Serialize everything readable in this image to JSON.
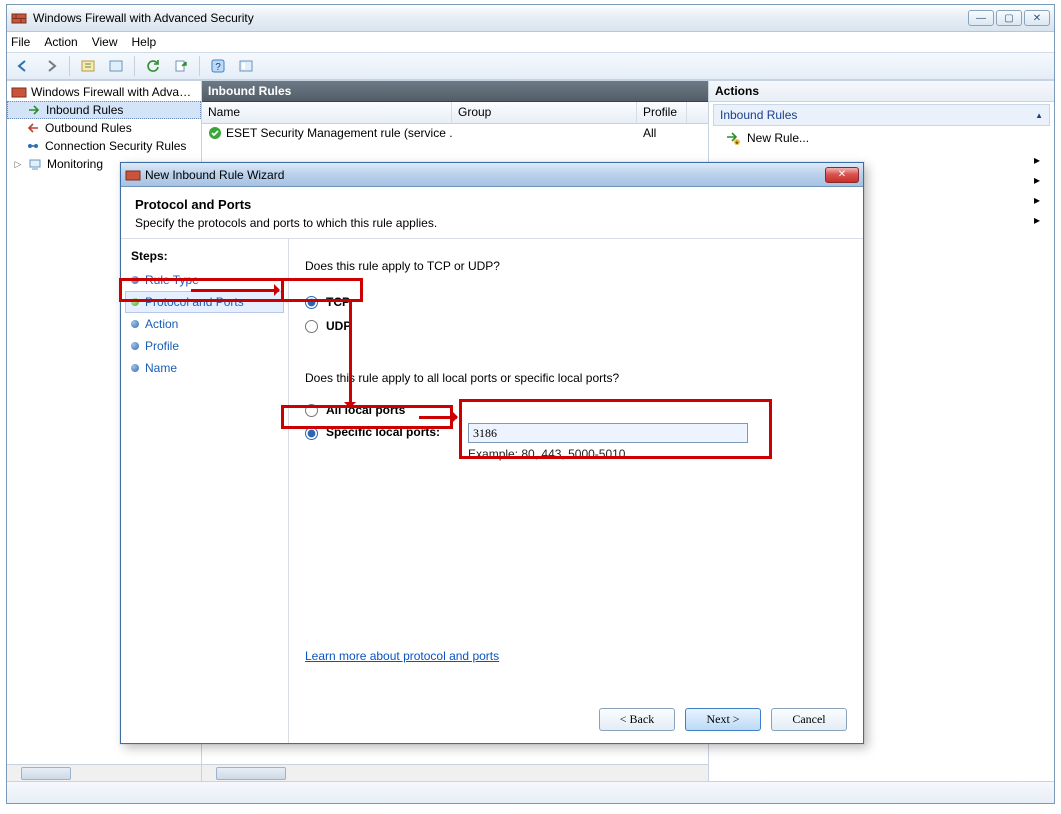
{
  "window": {
    "title": "Windows Firewall with Advanced Security",
    "menus": [
      "File",
      "Action",
      "View",
      "Help"
    ]
  },
  "win_buttons": {
    "min": "—",
    "max": "▢",
    "close": "✕"
  },
  "tree": {
    "root": "Windows Firewall with Advanced Security",
    "items": [
      "Inbound Rules",
      "Outbound Rules",
      "Connection Security Rules",
      "Monitoring"
    ]
  },
  "center": {
    "title": "Inbound Rules",
    "columns": {
      "name": "Name",
      "group": "Group",
      "profile": "Profile"
    },
    "col_widths": {
      "name": 250,
      "group": 185,
      "profile": 50
    },
    "row": {
      "name": "ESET Security Management rule (service ...",
      "group": "",
      "profile": "All"
    }
  },
  "actions": {
    "header": "Actions",
    "section": "Inbound Rules",
    "new_rule": "New Rule..."
  },
  "dialog": {
    "title": "New Inbound Rule Wizard",
    "heading": "Protocol and Ports",
    "subheading": "Specify the protocols and ports to which this rule applies.",
    "steps_label": "Steps:",
    "steps": [
      "Rule Type",
      "Protocol and Ports",
      "Action",
      "Profile",
      "Name"
    ],
    "q_proto": "Does this rule apply to TCP or UDP?",
    "tcp": "TCP",
    "udp": "UDP",
    "q_ports": "Does this rule apply to all local ports or specific local ports?",
    "all_ports": "All local ports",
    "specific": "Specific local ports:",
    "port_value": "3186",
    "example": "Example: 80, 443, 5000-5010",
    "learn_more": "Learn more about protocol and ports",
    "back": "< Back",
    "next": "Next >",
    "cancel": "Cancel"
  }
}
